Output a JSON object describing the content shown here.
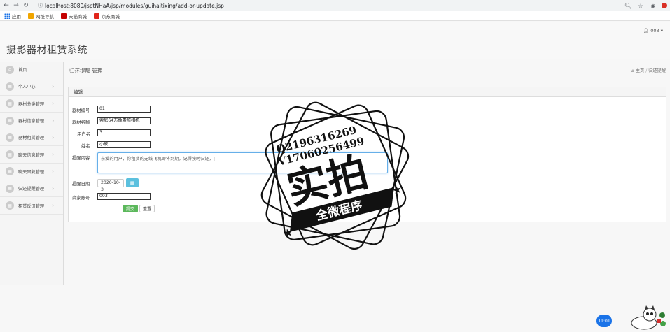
{
  "browser": {
    "url": "localhost:8080/jsptNHaA/jsp/modules/guihaitixing/add-or-update.jsp",
    "bookmarks": [
      "应用",
      "网址导航",
      "天猫商城",
      "京东商城"
    ]
  },
  "user_menu": "003",
  "app_title": "摄影器材租赁系统",
  "sidebar": {
    "items": [
      {
        "label": "首页",
        "icon": "home-icon"
      },
      {
        "label": "个人中心",
        "icon": "grid-icon"
      },
      {
        "label": "器材分类管理",
        "icon": "grid-icon"
      },
      {
        "label": "器材信息管理",
        "icon": "grid-icon"
      },
      {
        "label": "器材租赁管理",
        "icon": "grid-icon"
      },
      {
        "label": "聊天信息管理",
        "icon": "grid-icon"
      },
      {
        "label": "聊天回复管理",
        "icon": "grid-icon"
      },
      {
        "label": "归还提醒管理",
        "icon": "grid-icon"
      },
      {
        "label": "租赁反馈管理",
        "icon": "grid-icon"
      }
    ]
  },
  "page": {
    "heading": "归还提醒 管理",
    "breadcrumb_home": "主页",
    "breadcrumb_current": "归还提醒"
  },
  "panel": {
    "title": "编辑",
    "fields": {
      "equip_no": {
        "label": "器材编号",
        "value": "01"
      },
      "equip_name": {
        "label": "器材名称",
        "value": "索尼64万像素照相机"
      },
      "username": {
        "label": "用户名",
        "value": "3"
      },
      "name": {
        "label": "姓名",
        "value": "小敏"
      },
      "content": {
        "label": "提醒内容",
        "value": "亲爱的用户，你租赁的无线飞机即将到期，记得按时归还，|"
      },
      "date": {
        "label": "提醒日期",
        "value": "2020-10-3"
      },
      "merchant": {
        "label": "商家账号",
        "value": "003"
      }
    },
    "submit_label": "提交",
    "reset_label": "重置"
  },
  "watermark": {
    "line1": "Q2196316269",
    "line2": "V17060256499",
    "big": "实拍",
    "band": "全微程序"
  },
  "clock_badge": "11:01",
  "colors": {
    "submit": "#5cb85c",
    "calendar": "#5bc0de",
    "focus": "#66afe9"
  }
}
